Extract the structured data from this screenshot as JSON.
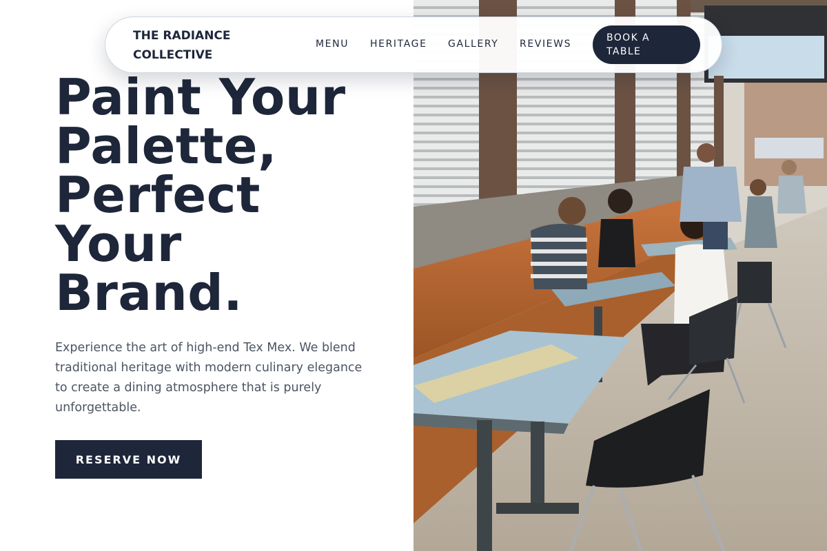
{
  "brand": {
    "line1": "THE RADIANCE",
    "line2": "COLLECTIVE"
  },
  "nav": {
    "links": [
      {
        "label": "MENU"
      },
      {
        "label": "HERITAGE"
      },
      {
        "label": "GALLERY"
      },
      {
        "label": "REVIEWS"
      }
    ],
    "cta_label": "BOOK A TABLE"
  },
  "hero": {
    "headline_lines": [
      "Paint Your",
      "Palette,",
      "Perfect",
      "Your",
      "Brand."
    ],
    "tagline": "Experience the art of high-end Tex Mex. We blend traditional heritage with modern culinary elegance to create a dining atmosphere that is purely unforgettable.",
    "cta_label": "RESERVE NOW",
    "photo_icon": "restaurant-patio-photo"
  },
  "colors": {
    "navy": "#1e263a",
    "text_muted": "#4b5563",
    "background": "#ffffff",
    "nav_border": "#cbd5e1"
  }
}
